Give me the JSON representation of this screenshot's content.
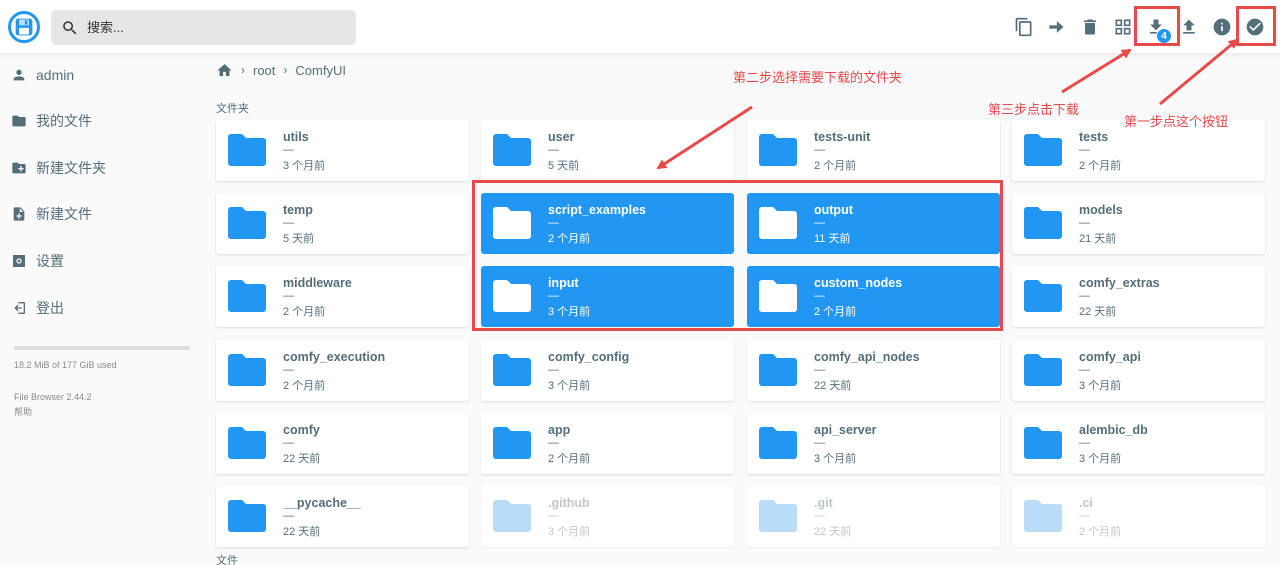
{
  "header": {
    "search_placeholder": "搜索...",
    "download_badge": "4",
    "actions": [
      "copy-icon",
      "move-icon",
      "delete-icon",
      "grid-view-icon",
      "download-icon",
      "upload-icon",
      "info-icon",
      "check-circle-icon"
    ]
  },
  "sidebar": {
    "items": [
      {
        "label": "admin",
        "icon": "person-icon"
      },
      {
        "label": "我的文件",
        "icon": "folder-icon"
      },
      {
        "label": "新建文件夹",
        "icon": "new-folder-icon"
      },
      {
        "label": "新建文件",
        "icon": "new-file-icon"
      },
      {
        "label": "设置",
        "icon": "settings-icon"
      },
      {
        "label": "登出",
        "icon": "logout-icon"
      }
    ],
    "usage": "18.2 MiB of 177 GiB used",
    "version": "File Browser 2.44.2",
    "help": "帮助"
  },
  "breadcrumb": [
    "root",
    "ComfyUI"
  ],
  "sections": {
    "folders": "文件夹",
    "files": "文件"
  },
  "folders": [
    {
      "name": "utils",
      "size": "—",
      "modified": "3 个月前",
      "state": "normal"
    },
    {
      "name": "user",
      "size": "—",
      "modified": "5 天前",
      "state": "normal"
    },
    {
      "name": "tests-unit",
      "size": "—",
      "modified": "2 个月前",
      "state": "normal"
    },
    {
      "name": "tests",
      "size": "—",
      "modified": "2 个月前",
      "state": "normal"
    },
    {
      "name": "temp",
      "size": "—",
      "modified": "5 天前",
      "state": "normal"
    },
    {
      "name": "script_examples",
      "size": "—",
      "modified": "2 个月前",
      "state": "selected"
    },
    {
      "name": "output",
      "size": "—",
      "modified": "11 天前",
      "state": "selected"
    },
    {
      "name": "models",
      "size": "—",
      "modified": "21 天前",
      "state": "normal"
    },
    {
      "name": "middleware",
      "size": "—",
      "modified": "2 个月前",
      "state": "normal"
    },
    {
      "name": "input",
      "size": "—",
      "modified": "3 个月前",
      "state": "selected"
    },
    {
      "name": "custom_nodes",
      "size": "—",
      "modified": "2 个月前",
      "state": "selected"
    },
    {
      "name": "comfy_extras",
      "size": "—",
      "modified": "22 天前",
      "state": "normal"
    },
    {
      "name": "comfy_execution",
      "size": "—",
      "modified": "2 个月前",
      "state": "normal"
    },
    {
      "name": "comfy_config",
      "size": "—",
      "modified": "3 个月前",
      "state": "normal"
    },
    {
      "name": "comfy_api_nodes",
      "size": "—",
      "modified": "22 天前",
      "state": "normal"
    },
    {
      "name": "comfy_api",
      "size": "—",
      "modified": "3 个月前",
      "state": "normal"
    },
    {
      "name": "comfy",
      "size": "—",
      "modified": "22 天前",
      "state": "normal"
    },
    {
      "name": "app",
      "size": "—",
      "modified": "2 个月前",
      "state": "normal"
    },
    {
      "name": "api_server",
      "size": "—",
      "modified": "3 个月前",
      "state": "normal"
    },
    {
      "name": "alembic_db",
      "size": "—",
      "modified": "3 个月前",
      "state": "normal"
    },
    {
      "name": "__pycache__",
      "size": "—",
      "modified": "22 天前",
      "state": "normal"
    },
    {
      "name": ".github",
      "size": "—",
      "modified": "3 个月前",
      "state": "hidden"
    },
    {
      "name": ".git",
      "size": "—",
      "modified": "22 天前",
      "state": "hidden"
    },
    {
      "name": ".ci",
      "size": "—",
      "modified": "2 个月前",
      "state": "hidden"
    }
  ],
  "annotations": {
    "step1": "第一步点这个按钮",
    "step2": "第二步选择需要下载的文件夹",
    "step3": "第三步点击下载"
  },
  "colors": {
    "accent": "#2196f3",
    "annotation": "#e84a4a"
  }
}
